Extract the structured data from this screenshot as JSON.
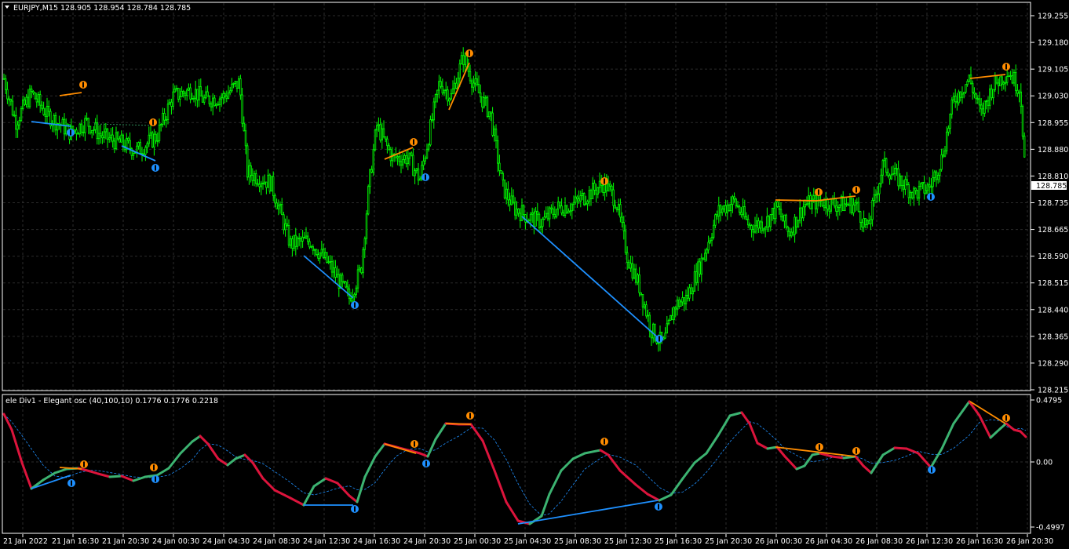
{
  "main_chart": {
    "header": "EURJPY,M15  128.905 128.954 128.784 128.785",
    "price_axis": [
      "129.255",
      "129.180",
      "129.105",
      "129.030",
      "128.955",
      "128.880",
      "128.810",
      "128.735",
      "128.665",
      "128.590",
      "128.515",
      "128.440",
      "128.365",
      "128.290",
      "128.215"
    ],
    "current_price": "128.785",
    "candle_color": "#00ff00"
  },
  "sub_chart": {
    "header": "ele Div1 - Elegant osc (40,100,10) 0.1776 0.1776 0.2218",
    "axis_labels": [
      "0.4795",
      "0.00",
      "-0.4997"
    ]
  },
  "time_axis": [
    "21 Jan 2022",
    "21 Jan 16:30",
    "21 Jan 20:30",
    "24 Jan 00:30",
    "24 Jan 04:30",
    "24 Jan 08:30",
    "24 Jan 12:30",
    "24 Jan 16:30",
    "24 Jan 20:30",
    "25 Jan 00:30",
    "25 Jan 04:30",
    "25 Jan 08:30",
    "25 Jan 12:30",
    "25 Jan 16:30",
    "25 Jan 20:30",
    "26 Jan 00:30",
    "26 Jan 04:30",
    "26 Jan 08:30",
    "26 Jan 12:30",
    "26 Jan 16:30",
    "26 Jan 20:30"
  ],
  "colors": {
    "background": "#000000",
    "grid": "#2b2b2b",
    "frame": "#ffffff",
    "bull_osc": "#3cb371",
    "bear_osc": "#dc143c",
    "signal": "#1e90ff",
    "bear_div": "#ff8c00",
    "bull_div": "#1e90ff"
  },
  "icons": {
    "dropdown": "triangle-down-icon",
    "bearish_marker": "orange-down-arrow-icon",
    "bullish_marker": "blue-up-arrow-icon"
  }
}
